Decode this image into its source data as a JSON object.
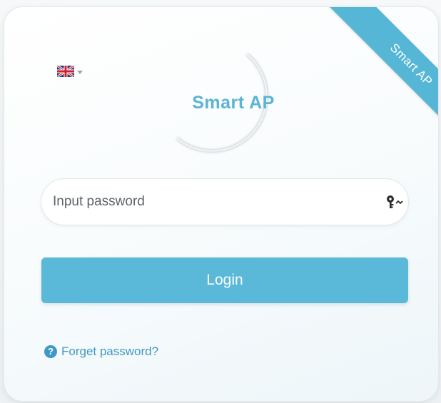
{
  "ribbon": {
    "label": "Smart AP",
    "color": "#55b6d6"
  },
  "language": {
    "flag_icon": "uk-flag-icon",
    "selected": "English"
  },
  "logo": {
    "text": "Smart AP",
    "color": "#5ab4d6"
  },
  "password": {
    "placeholder": "Input password",
    "value": "",
    "toggle_icon": "key-icon"
  },
  "login": {
    "label": "Login",
    "color": "#5ab8d8"
  },
  "forget": {
    "label": "Forget password?",
    "icon": "question-circle-icon",
    "color": "#3f99c6"
  }
}
